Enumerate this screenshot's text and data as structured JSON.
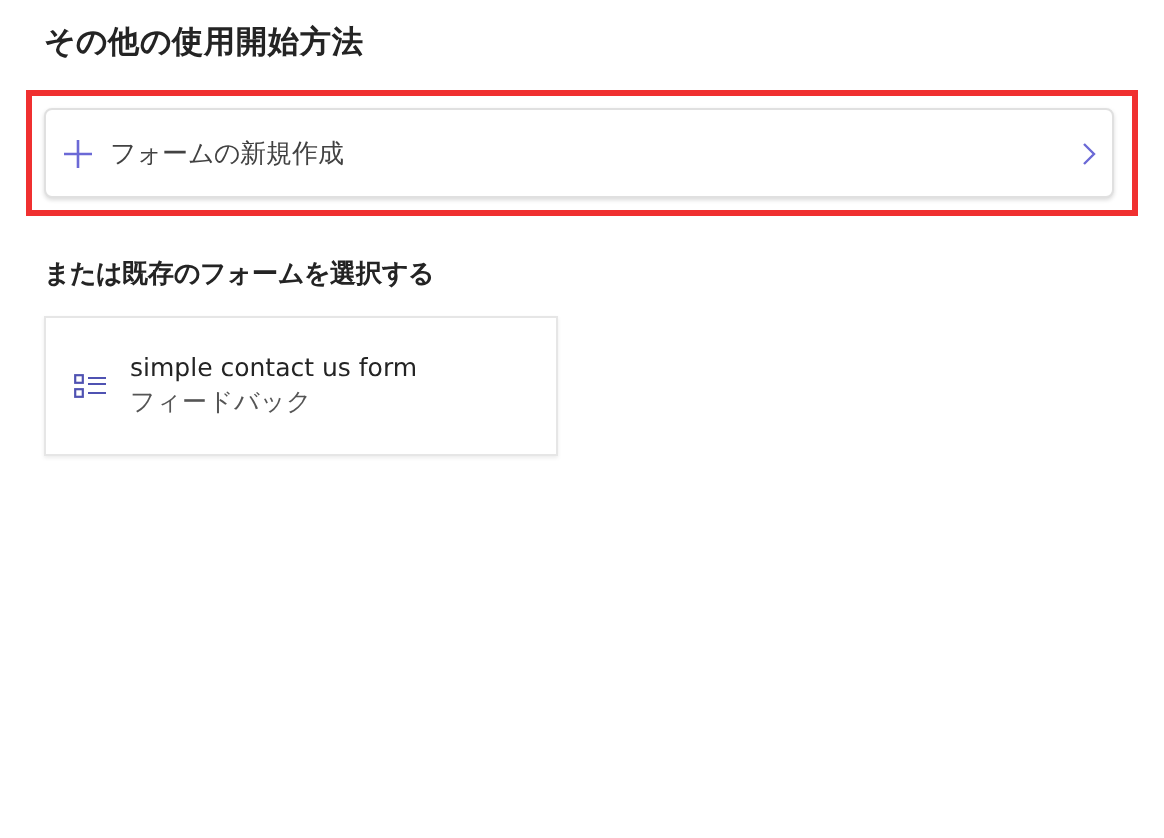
{
  "heading": "その他の使用開始方法",
  "new_form": {
    "label": "フォームの新規作成",
    "highlighted": true
  },
  "existing_heading": "または既存のフォームを選択する",
  "forms": [
    {
      "title": "simple contact us form",
      "subtitle": "フィードバック"
    }
  ]
}
